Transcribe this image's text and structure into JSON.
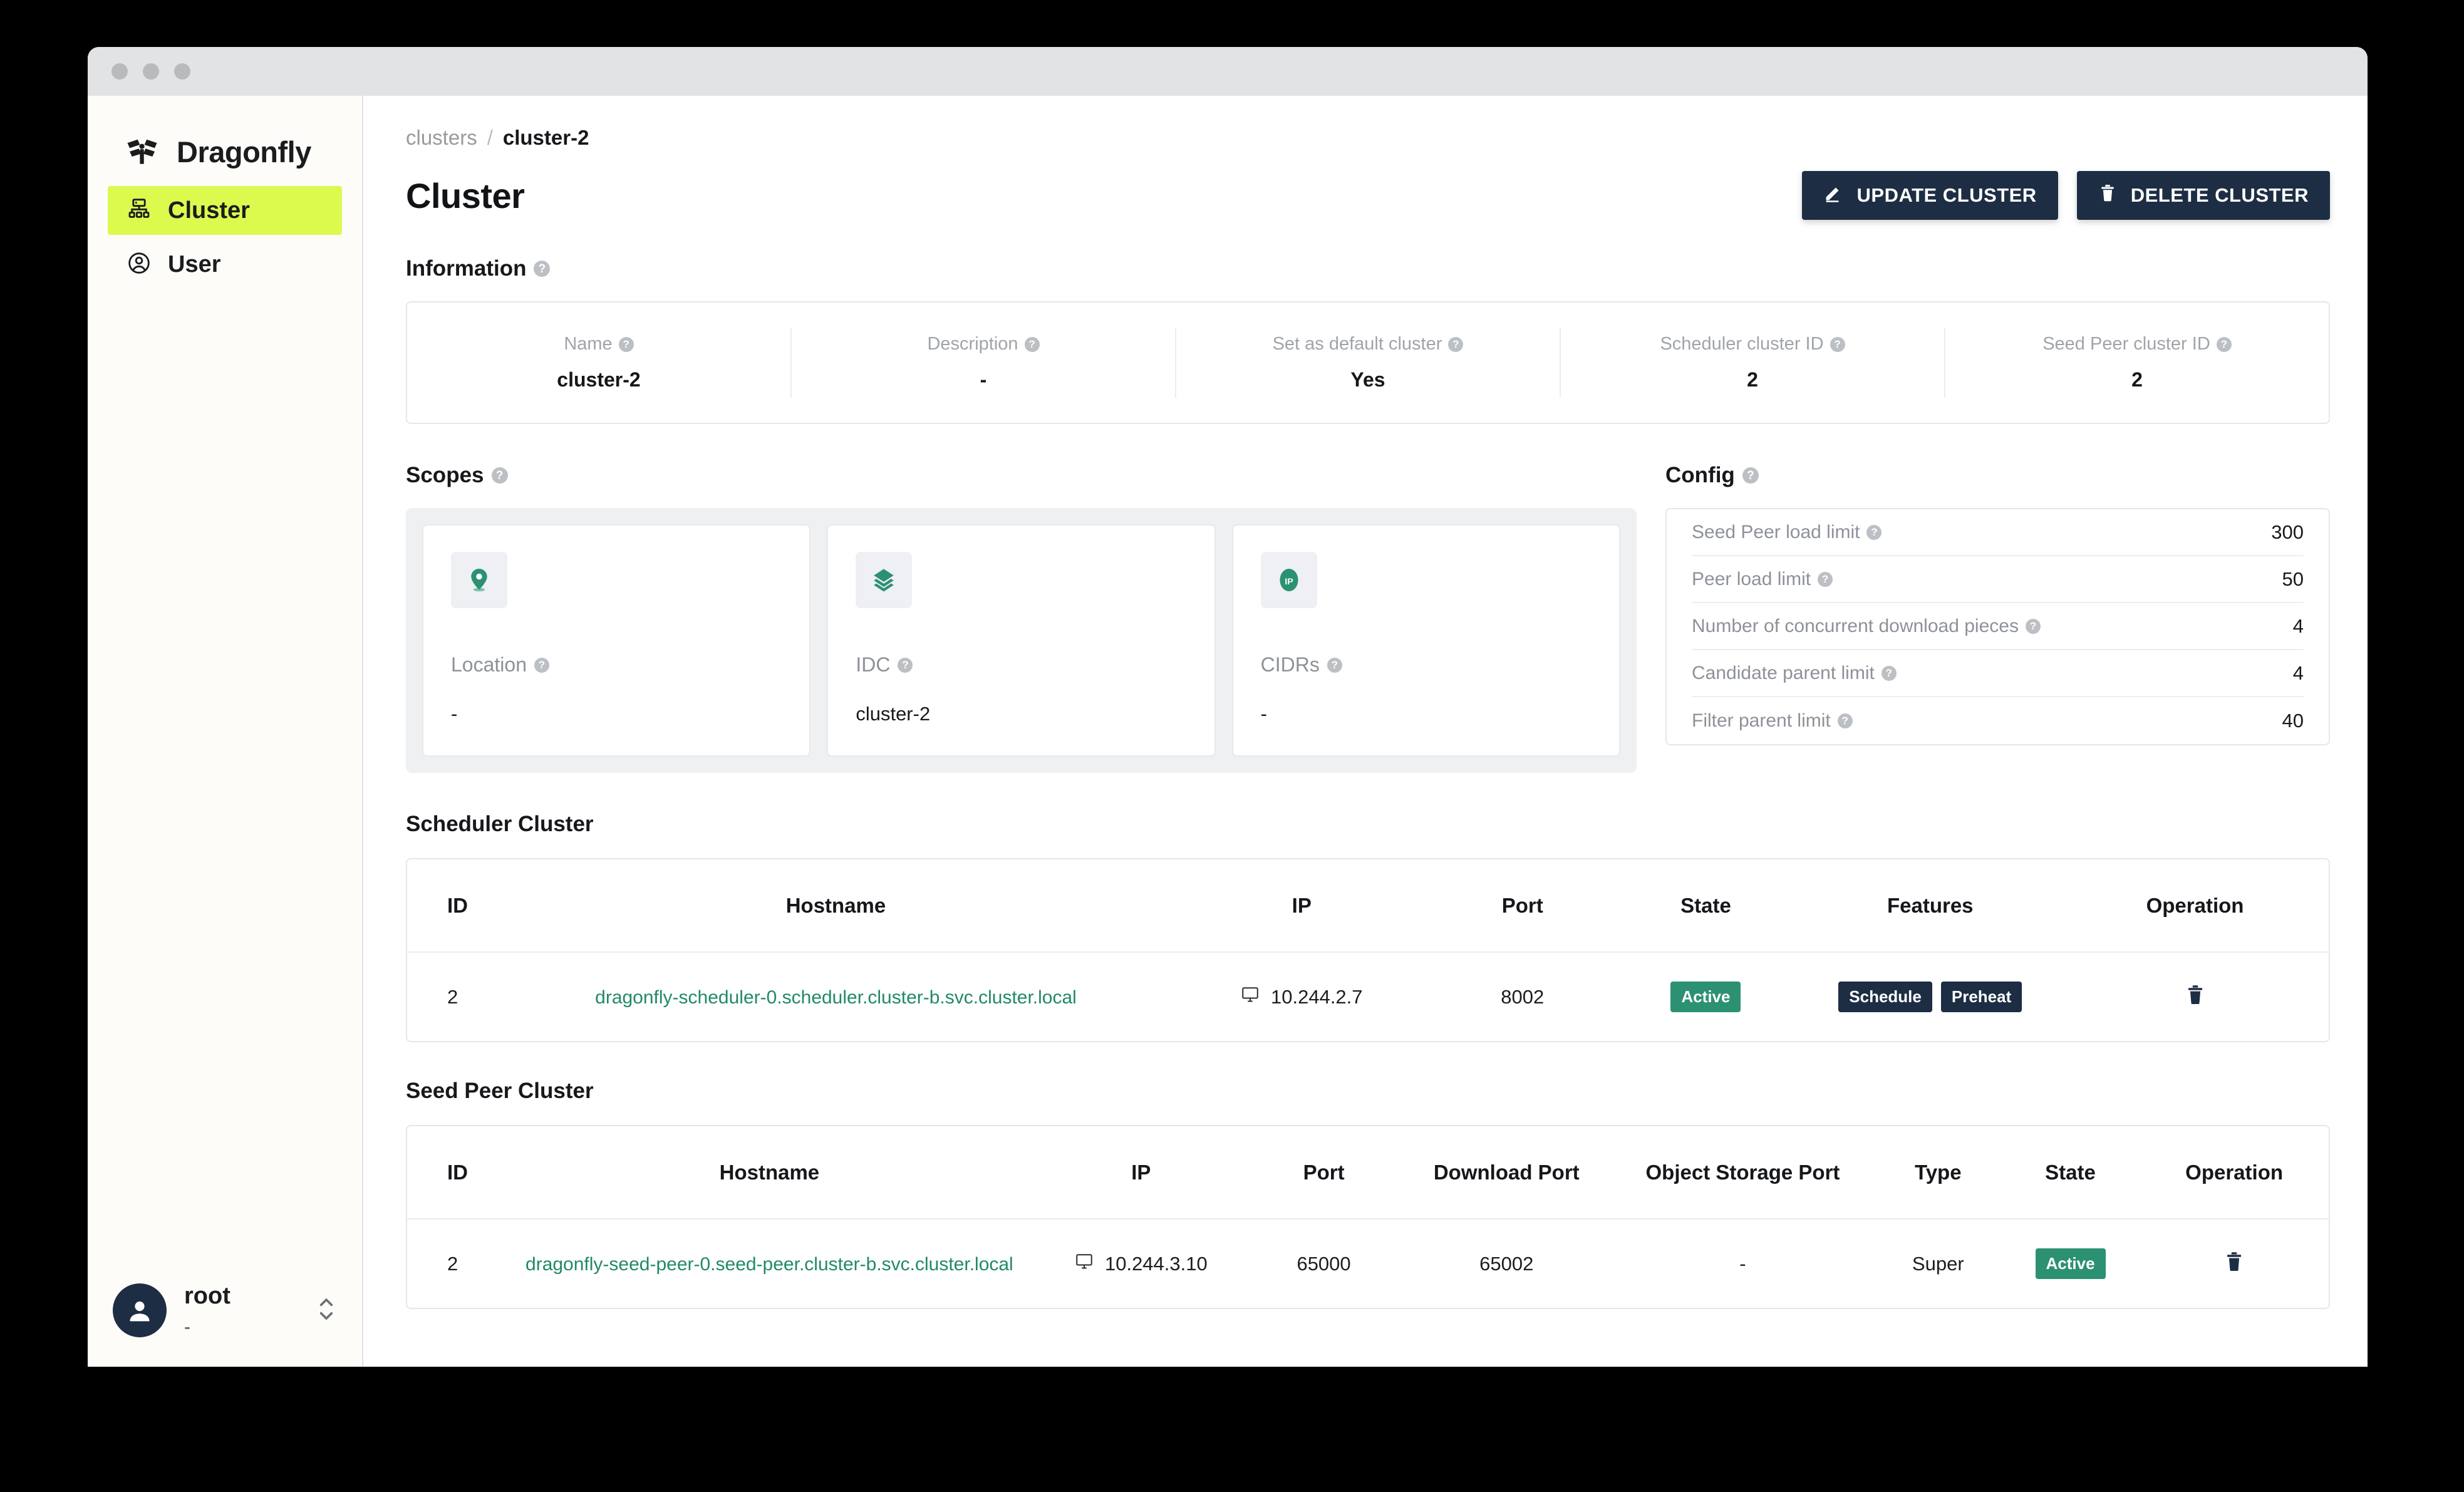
{
  "window": {
    "traffic_lights": [
      "close-dot",
      "minimize-dot",
      "maximize-dot"
    ]
  },
  "sidebar": {
    "brand": "Dragonfly",
    "brand_icon": "dragonfly-logo-icon",
    "items": [
      {
        "label": "Cluster",
        "icon": "cluster-icon",
        "active": true
      },
      {
        "label": "User",
        "icon": "user-circle-icon",
        "active": false
      }
    ],
    "user": {
      "name": "root",
      "subtitle": "-",
      "avatar_icon": "avatar-person-icon",
      "expand_icon": "chevron-up-down-icon"
    },
    "highlight_color": "#dcfa4e"
  },
  "breadcrumb": {
    "parent": "clusters",
    "separator": "/",
    "current": "cluster-2"
  },
  "header": {
    "title": "Cluster",
    "update_button": "UPDATE CLUSTER",
    "update_icon": "pencil-icon",
    "delete_button": "DELETE CLUSTER",
    "delete_icon": "trash-icon",
    "button_color": "#1d2d44"
  },
  "information": {
    "heading": "Information",
    "help_glyph": "?",
    "fields": [
      {
        "label": "Name",
        "value": "cluster-2"
      },
      {
        "label": "Description",
        "value": "-"
      },
      {
        "label": "Set as default cluster",
        "value": "Yes"
      },
      {
        "label": "Scheduler cluster ID",
        "value": "2"
      },
      {
        "label": "Seed Peer cluster ID",
        "value": "2"
      }
    ]
  },
  "scopes": {
    "heading": "Scopes",
    "cards": [
      {
        "label": "Location",
        "value": "-",
        "icon": "location-pin-icon"
      },
      {
        "label": "IDC",
        "value": "cluster-2",
        "icon": "layers-icon"
      },
      {
        "label": "CIDRs",
        "value": "-",
        "icon": "ip-badge-icon"
      }
    ]
  },
  "config": {
    "heading": "Config",
    "rows": [
      {
        "label": "Seed Peer load limit",
        "value": "300"
      },
      {
        "label": "Peer load limit",
        "value": "50"
      },
      {
        "label": "Number of concurrent download pieces",
        "value": "4"
      },
      {
        "label": "Candidate parent limit",
        "value": "4"
      },
      {
        "label": "Filter parent limit",
        "value": "40"
      }
    ]
  },
  "scheduler_cluster": {
    "heading": "Scheduler Cluster",
    "columns": [
      "ID",
      "Hostname",
      "IP",
      "Port",
      "State",
      "Features",
      "Operation"
    ],
    "rows": [
      {
        "id": "2",
        "hostname": "dragonfly-scheduler-0.scheduler.cluster-b.svc.cluster.local",
        "ip": "10.244.2.7",
        "ip_icon": "monitor-icon",
        "port": "8002",
        "state": "Active",
        "features": [
          "Schedule",
          "Preheat"
        ],
        "operation_icon": "trash-icon"
      }
    ]
  },
  "seed_peer_cluster": {
    "heading": "Seed Peer Cluster",
    "columns": [
      "ID",
      "Hostname",
      "IP",
      "Port",
      "Download Port",
      "Object Storage Port",
      "Type",
      "State",
      "Operation"
    ],
    "rows": [
      {
        "id": "2",
        "hostname": "dragonfly-seed-peer-0.seed-peer.cluster-b.svc.cluster.local",
        "ip": "10.244.3.10",
        "ip_icon": "monitor-icon",
        "port": "65000",
        "download_port": "65002",
        "object_storage_port": "-",
        "type": "Super",
        "state": "Active",
        "operation_icon": "trash-icon"
      }
    ]
  },
  "colors": {
    "accent_lime": "#dcfa4e",
    "dark_navy": "#1d2d44",
    "green_state": "#2c9173",
    "link_green": "#21896a"
  }
}
